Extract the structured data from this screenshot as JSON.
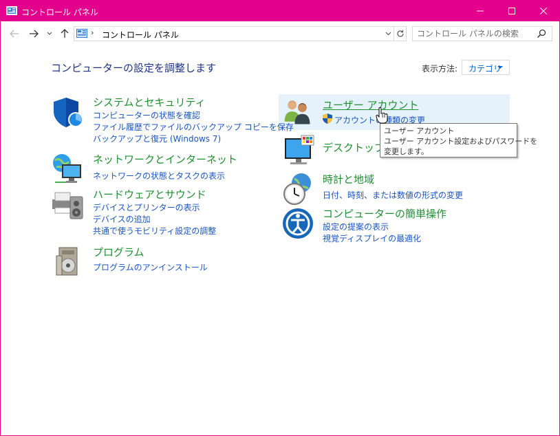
{
  "window": {
    "title": "コントロール パネル",
    "accent_color": "#e3008c",
    "controls": [
      "minimize-icon",
      "maximize-icon",
      "close-icon"
    ]
  },
  "address_bar": {
    "nav_icons": [
      "back-arrow-icon",
      "forward-arrow-icon",
      "recent-chevron-icon",
      "up-arrow-icon"
    ],
    "separator": "›",
    "breadcrumb": "コントロール パネル",
    "search_placeholder": "コントロール パネルの検索"
  },
  "main": {
    "heading": "コンピューターの設定を調整します",
    "view_by_label": "表示方法:",
    "view_by_value": "カテゴリ",
    "categories": [
      {
        "title": "システムとセキュリティ",
        "icon": "shield-icon",
        "links": [
          "コンピューターの状態を確認",
          "ファイル履歴でファイルのバックアップ コピーを保存",
          "バックアップと復元 (Windows 7)"
        ]
      },
      {
        "title": "ネットワークとインターネット",
        "icon": "network-globe-icon",
        "links": [
          "ネットワークの状態とタスクの表示"
        ]
      },
      {
        "title": "ハードウェアとサウンド",
        "icon": "printer-speaker-icon",
        "links": [
          "デバイスとプリンターの表示",
          "デバイスの追加",
          "共通で使うモビリティ設定の調整"
        ]
      },
      {
        "title": "プログラム",
        "icon": "programs-disc-icon",
        "links": [
          "プログラムのアンインストール"
        ]
      },
      {
        "title": "ユーザー アカウント",
        "icon": "users-icon",
        "links": [
          "アカウントの種類の変更"
        ]
      },
      {
        "title": "デスクトップのカスタマイズ",
        "icon": "desktop-palette-icon",
        "links": []
      },
      {
        "title": "時計と地域",
        "icon": "clock-globe-icon",
        "links": [
          "日付、時刻、または数値の形式の変更"
        ]
      },
      {
        "title": "コンピューターの簡単操作",
        "icon": "ease-of-access-icon",
        "links": [
          "設定の提案の表示",
          "視覚ディスプレイの最適化"
        ]
      }
    ]
  },
  "tooltip": {
    "line1": "ユーザー アカウント",
    "line2": "ユーザー アカウント設定およびパスワードを",
    "line3": "変更します。"
  }
}
